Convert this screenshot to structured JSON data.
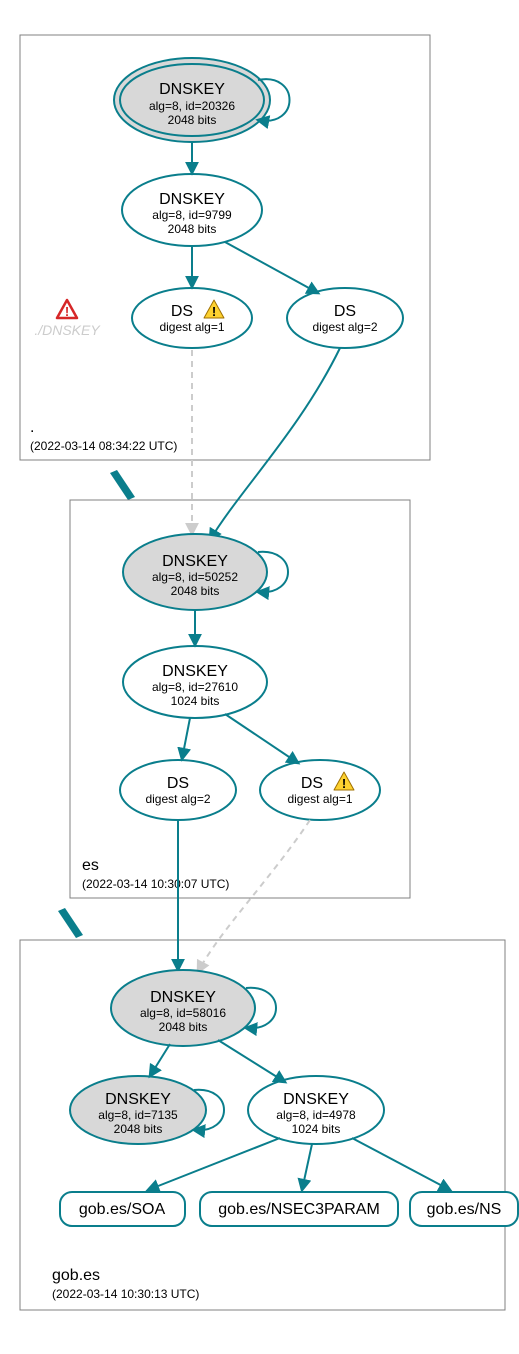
{
  "colors": {
    "teal": "#0a7e8c",
    "node_gray": "#d8d8d8",
    "box_stroke": "#808080",
    "dashed_gray": "#cccccc"
  },
  "zones": [
    {
      "name": ".",
      "name_display": ".",
      "timestamp": "(2022-03-14 08:34:22 UTC)",
      "nodes": {
        "root_ksk": {
          "title": "DNSKEY",
          "line2": "alg=8, id=20326",
          "line3": "2048 bits",
          "trust_anchor": true
        },
        "root_zsk": {
          "title": "DNSKEY",
          "line2": "alg=8, id=9799",
          "line3": "2048 bits"
        },
        "root_ds1": {
          "title": "DS",
          "line2": "digest alg=1",
          "warn": true
        },
        "root_ds2": {
          "title": "DS",
          "line2": "digest alg=2"
        },
        "root_missing": {
          "label": "./DNSKEY",
          "error": true
        }
      }
    },
    {
      "name": "es",
      "timestamp": "(2022-03-14 10:30:07 UTC)",
      "nodes": {
        "es_ksk": {
          "title": "DNSKEY",
          "line2": "alg=8, id=50252",
          "line3": "2048 bits"
        },
        "es_zsk": {
          "title": "DNSKEY",
          "line2": "alg=8, id=27610",
          "line3": "1024 bits"
        },
        "es_ds2": {
          "title": "DS",
          "line2": "digest alg=2"
        },
        "es_ds1": {
          "title": "DS",
          "line2": "digest alg=1",
          "warn": true
        }
      }
    },
    {
      "name": "gob.es",
      "timestamp": "(2022-03-14 10:30:13 UTC)",
      "nodes": {
        "gob_ksk": {
          "title": "DNSKEY",
          "line2": "alg=8, id=58016",
          "line3": "2048 bits"
        },
        "gob_k2": {
          "title": "DNSKEY",
          "line2": "alg=8, id=7135",
          "line3": "2048 bits"
        },
        "gob_zsk": {
          "title": "DNSKEY",
          "line2": "alg=8, id=4978",
          "line3": "1024 bits"
        },
        "gob_soa": {
          "label": "gob.es/SOA"
        },
        "gob_nsec": {
          "label": "gob.es/NSEC3PARAM"
        },
        "gob_ns": {
          "label": "gob.es/NS"
        }
      }
    }
  ]
}
